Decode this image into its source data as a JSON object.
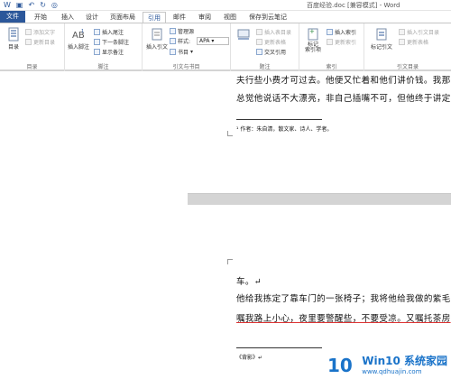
{
  "window": {
    "title": "百度经验.doc [兼容模式] - Word"
  },
  "tabs": [
    "文件",
    "开始",
    "插入",
    "设计",
    "页面布局",
    "引用",
    "邮件",
    "审阅",
    "视图",
    "保存到云笔记"
  ],
  "active_tab": "引用",
  "ribbon": {
    "toc": {
      "big": "目录",
      "add_text": "添加文字",
      "update": "更新目录",
      "group": "目录"
    },
    "footnotes": {
      "insert": "插入脚注",
      "insert_endnote": "插入尾注",
      "next": "下一条脚注",
      "show": "显示备注",
      "group": "脚注"
    },
    "citations": {
      "insert": "插入引文",
      "manage": "管理源",
      "style_label": "样式:",
      "style_value": "APA",
      "bib": "书目",
      "group": "引文与书目"
    },
    "captions": {
      "insert_table_fig": "插入表目录",
      "update_table": "更新表格",
      "cross_ref": "交叉引用",
      "group": "题注"
    },
    "index": {
      "mark": "标记\n索引项",
      "insert_index": "插入索引",
      "update_index": "更新索引",
      "group": "索引"
    },
    "toa": {
      "mark": "标记引文",
      "insert": "插入引文目录",
      "update": "更新表格",
      "group": "引文目录"
    }
  },
  "document": {
    "page1_line1": "夫行些小费才可过去。他便又忙着和他们讲价钱。我那",
    "page1_line2": "总觉他说话不大漂亮，非自己插嘴不可，但他终于讲定了",
    "footnote": "¹ 作者：朱自清，散文家、诗人、学者。",
    "page2_line1": "车。↵",
    "page2_line2": "他给我拣定了靠车门的一张椅子；我将他给我做的紫毛",
    "page2_line3": "嘱我路上小心，夜里要警醒些，不要受凉。又嘱托茶房",
    "page2_footnote": "《背影》↵"
  },
  "watermark": {
    "brand": "Win10 系统家园",
    "url": "www.qdhuajin.com"
  },
  "colors": {
    "accent": "#2b579a",
    "watermark": "#1a73c9"
  }
}
